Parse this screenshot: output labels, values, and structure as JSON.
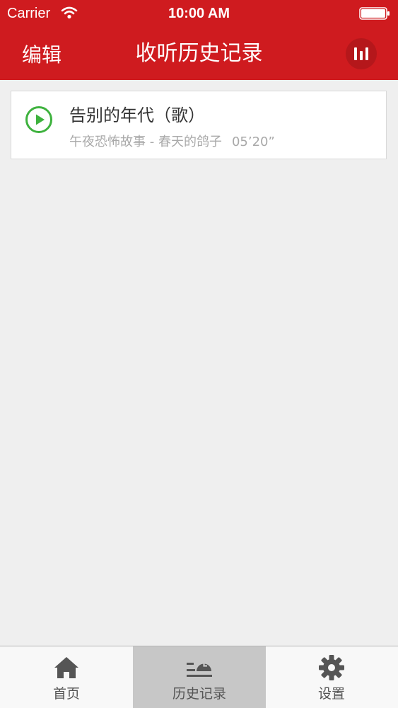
{
  "status_bar": {
    "carrier": "Carrier",
    "time": "10:00 AM",
    "wifi_icon": "wifi-icon",
    "battery_icon": "battery-full-icon"
  },
  "nav": {
    "edit_label": "编辑",
    "title": "收听历史记录",
    "now_playing_icon": "equalizer-bars-icon"
  },
  "history": {
    "items": [
      {
        "title": "告别的年代（歌）",
        "program": "午夜恐怖故事 - 春天的鸽子",
        "duration": "05’20”",
        "icon": "play-circle-icon"
      }
    ]
  },
  "tabs": [
    {
      "label": "首页",
      "icon": "home-icon",
      "active": false
    },
    {
      "label": "历史记录",
      "icon": "history-clock-icon",
      "active": true
    },
    {
      "label": "设置",
      "icon": "gear-icon",
      "active": false
    }
  ],
  "colors": {
    "brand_red": "#cf1b1f",
    "play_green": "#3eb23e",
    "background": "#efefef",
    "tab_active": "#c7c7c7",
    "tab_icon": "#555555",
    "subtitle_gray": "#a9a9a9"
  }
}
